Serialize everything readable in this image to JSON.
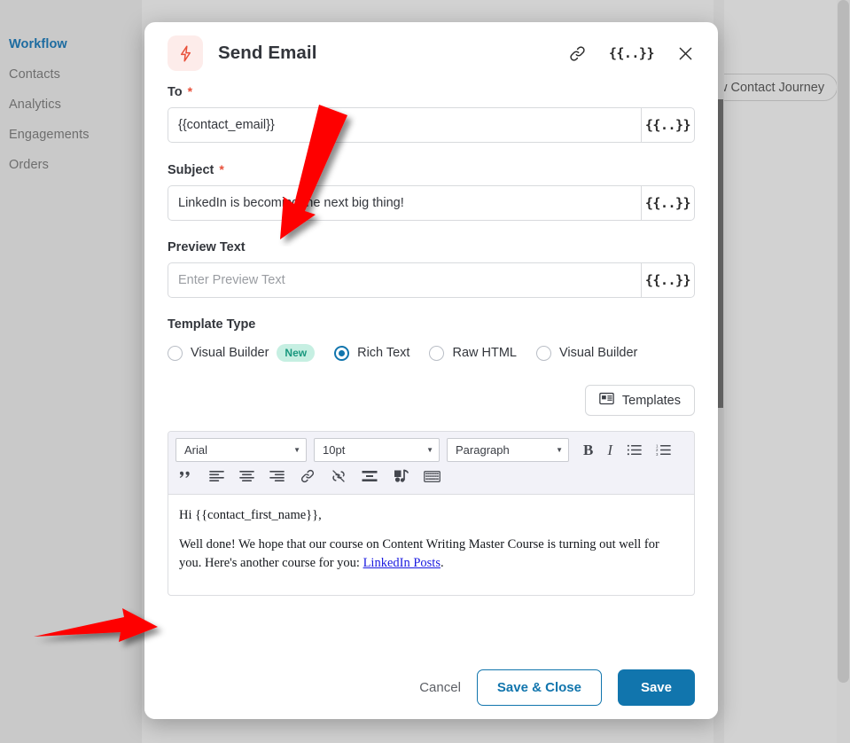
{
  "background": {
    "sidebar": {
      "items": [
        {
          "label": "Workflow",
          "active": true
        },
        {
          "label": "Contacts",
          "active": false
        },
        {
          "label": "Analytics",
          "active": false
        },
        {
          "label": "Engagements",
          "active": false
        },
        {
          "label": "Orders",
          "active": false
        }
      ]
    },
    "journey_button_label": "w Contact Journey"
  },
  "modal": {
    "title": "Send Email",
    "icon": "lightning-bolt-icon",
    "header_actions": {
      "link_icon": "link-icon",
      "token_label": "{{..}}",
      "close_icon": "close-icon"
    },
    "fields": {
      "to": {
        "label": "To",
        "required": true,
        "value": "{{contact_email}}",
        "token_label": "{{..}}"
      },
      "subject": {
        "label": "Subject",
        "required": true,
        "value": "LinkedIn is becoming the next big thing!",
        "token_label": "{{..}}"
      },
      "preview_text": {
        "label": "Preview Text",
        "required": false,
        "value": "",
        "placeholder": "Enter Preview Text",
        "token_label": "{{..}}"
      }
    },
    "template_type": {
      "label": "Template Type",
      "options": [
        {
          "label": "Visual Builder",
          "selected": false,
          "badge": "New"
        },
        {
          "label": "Rich Text",
          "selected": true,
          "badge": ""
        },
        {
          "label": "Raw HTML",
          "selected": false,
          "badge": ""
        },
        {
          "label": "Visual Builder",
          "selected": false,
          "badge": ""
        }
      ]
    },
    "templates_button": {
      "label": "Templates",
      "icon": "template-card-icon"
    },
    "editor": {
      "toolbar": {
        "font_family": "Arial",
        "font_size": "10pt",
        "block_format": "Paragraph",
        "buttons_row1": [
          "bold-icon",
          "italic-icon",
          "bullet-list-icon",
          "numbered-list-icon"
        ],
        "buttons_row2": [
          "blockquote-icon",
          "align-left-icon",
          "align-center-icon",
          "align-right-icon",
          "link-icon",
          "unlink-icon",
          "horizontal-rule-icon",
          "media-icon",
          "source-code-icon"
        ]
      },
      "content": {
        "greeting": "Hi {{contact_first_name}},",
        "body_before_link": "Well done! We hope that our course on Content Writing Master Course is turning out well for you. Here's another course for you: ",
        "link_text": "LinkedIn Posts",
        "body_after_link": "."
      }
    },
    "footer": {
      "cancel_label": "Cancel",
      "save_close_label": "Save & Close",
      "save_label": "Save"
    }
  },
  "colors": {
    "accent_blue": "#1175ad",
    "brand_red": "#e8503a",
    "badge_teal_bg": "#c6efe2",
    "badge_teal_text": "#19987e",
    "annotation_red": "#fe0000"
  }
}
